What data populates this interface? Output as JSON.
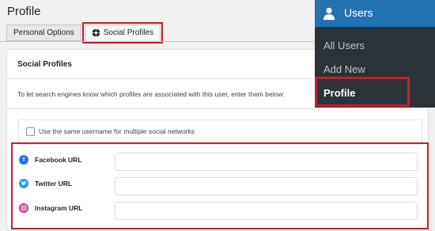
{
  "page": {
    "title": "Profile"
  },
  "tabs": [
    {
      "label": "Personal Options",
      "active": false
    },
    {
      "label": "Social Profiles",
      "active": true,
      "icon": "settings-icon"
    }
  ],
  "card": {
    "title": "Social Profiles",
    "description": "To let search engines know which profiles are associated with this user, enter them below:",
    "checkbox_label": "Use the same username for multiple social networks",
    "checkbox_checked": false
  },
  "social_fields": [
    {
      "label": "Facebook URL",
      "icon": "facebook-icon",
      "color": "#1877f2",
      "value": ""
    },
    {
      "label": "Twitter URL",
      "icon": "twitter-icon",
      "color": "#1da1f2",
      "value": ""
    },
    {
      "label": "Instagram URL",
      "icon": "instagram-icon",
      "color": "#c13584",
      "value": ""
    }
  ],
  "admin_menu": {
    "heading": "Users",
    "heading_icon": "user-icon",
    "items": [
      {
        "label": "All Users",
        "current": false
      },
      {
        "label": "Add New",
        "current": false
      },
      {
        "label": "Profile",
        "current": true
      }
    ]
  },
  "colors": {
    "highlight": "#c0202c",
    "menu_bg": "#2c3338",
    "menu_head_bg": "#2271b1"
  }
}
